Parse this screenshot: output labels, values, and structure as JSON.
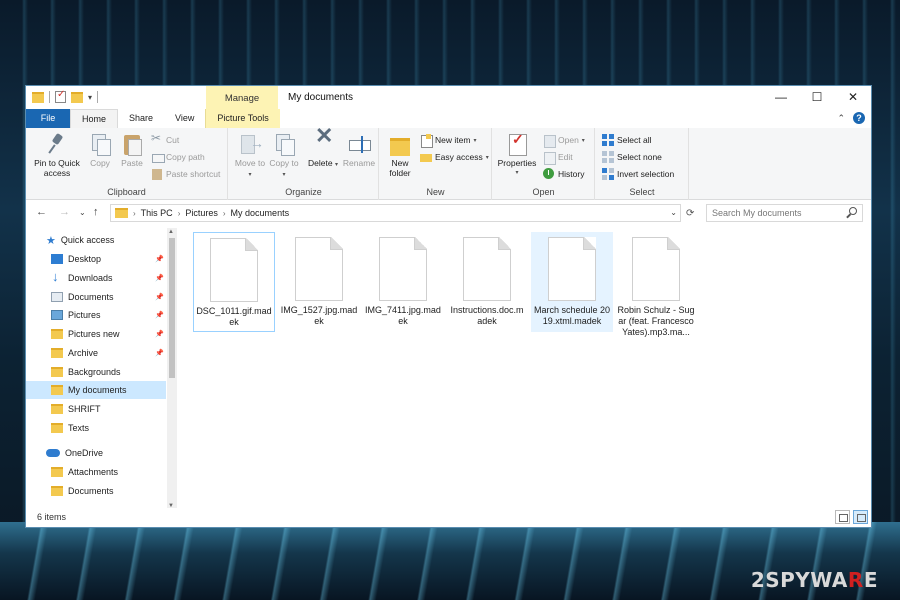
{
  "window": {
    "title": "My documents",
    "manage_tab": "Manage",
    "controls": {
      "minimize": "—",
      "maximize": "☐",
      "close": "✕"
    }
  },
  "tabs": {
    "file": "File",
    "home": "Home",
    "share": "Share",
    "view": "View",
    "picture_tools": "Picture Tools"
  },
  "ribbon": {
    "clipboard": {
      "label": "Clipboard",
      "pin": "Pin to Quick access",
      "copy": "Copy",
      "paste": "Paste",
      "cut": "Cut",
      "copy_path": "Copy path",
      "paste_shortcut": "Paste shortcut"
    },
    "organize": {
      "label": "Organize",
      "move_to": "Move to",
      "copy_to": "Copy to",
      "delete": "Delete",
      "rename": "Rename"
    },
    "new": {
      "label": "New",
      "new_folder": "New folder",
      "new_item": "New item",
      "easy_access": "Easy access"
    },
    "open": {
      "label": "Open",
      "properties": "Properties",
      "open": "Open",
      "edit": "Edit",
      "history": "History"
    },
    "select": {
      "label": "Select",
      "select_all": "Select all",
      "select_none": "Select none",
      "invert_selection": "Invert selection"
    }
  },
  "address": {
    "path": [
      "This PC",
      "Pictures",
      "My documents"
    ],
    "search_placeholder": "Search My documents"
  },
  "nav": {
    "quick_access": "Quick access",
    "items": [
      {
        "label": "Desktop",
        "pinned": true
      },
      {
        "label": "Downloads",
        "pinned": true
      },
      {
        "label": "Documents",
        "pinned": true
      },
      {
        "label": "Pictures",
        "pinned": true
      },
      {
        "label": "Pictures new",
        "pinned": true
      },
      {
        "label": "Archive",
        "pinned": true
      },
      {
        "label": "Backgrounds",
        "pinned": false
      },
      {
        "label": "My documents",
        "pinned": false,
        "selected": true
      },
      {
        "label": "SHRIFT",
        "pinned": false
      },
      {
        "label": "Texts",
        "pinned": false
      }
    ],
    "onedrive": "OneDrive",
    "onedrive_items": [
      {
        "label": "Attachments"
      },
      {
        "label": "Documents"
      }
    ]
  },
  "files": [
    {
      "name": "DSC_1011.gif.madek"
    },
    {
      "name": "IMG_1527.jpg.madek"
    },
    {
      "name": "IMG_7411.jpg.madek"
    },
    {
      "name": "Instructions.doc.madek"
    },
    {
      "name": "March schedule 2019.xtml.madek"
    },
    {
      "name": "Robin Schulz - Sugar (feat. Francesco Yates).mp3.ma..."
    }
  ],
  "status": {
    "item_count": "6 items"
  },
  "watermark": {
    "prefix": "2SPYWA",
    "r": "R",
    "suffix": "E"
  }
}
